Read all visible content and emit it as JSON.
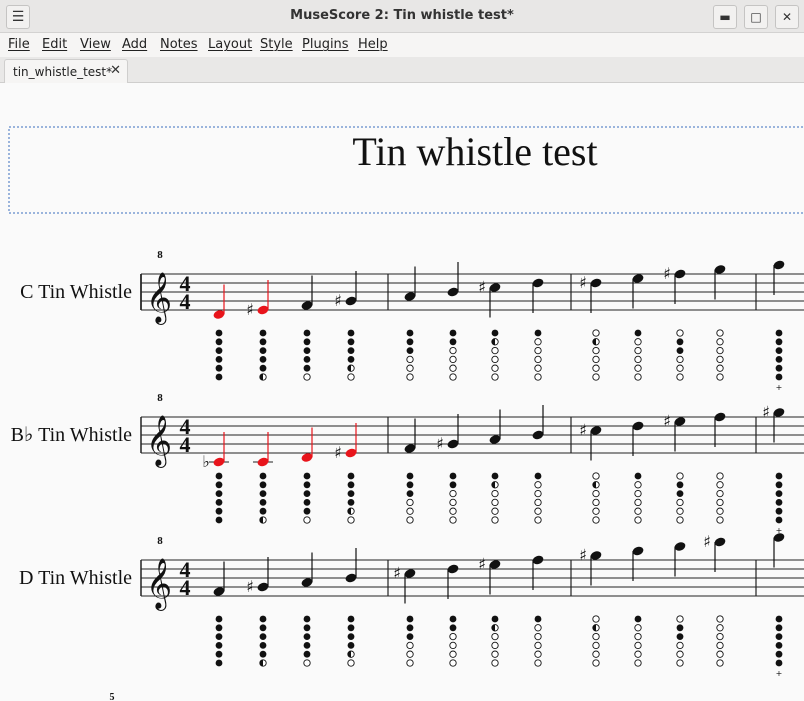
{
  "window": {
    "title": "MuseScore 2: Tin whistle test*",
    "menu_icon": "hamburger-icon",
    "controls": [
      "minimize-icon",
      "maximize-icon",
      "close-icon"
    ]
  },
  "menu": [
    "File",
    "Edit",
    "View",
    "Add",
    "Notes",
    "Layout",
    "Style",
    "Plugins",
    "Help"
  ],
  "tab": {
    "label": "tin_whistle_test*",
    "close_icon": "close-icon"
  },
  "score": {
    "title": "Tin whistle test",
    "instruments": [
      "C Tin Whistle",
      "B♭ Tin Whistle",
      "D Tin Whistle"
    ],
    "time_signature": "4/4",
    "clef_octave_mark": "8",
    "next_system_measure_number": "5",
    "highlight_color": "#e8141b"
  }
}
